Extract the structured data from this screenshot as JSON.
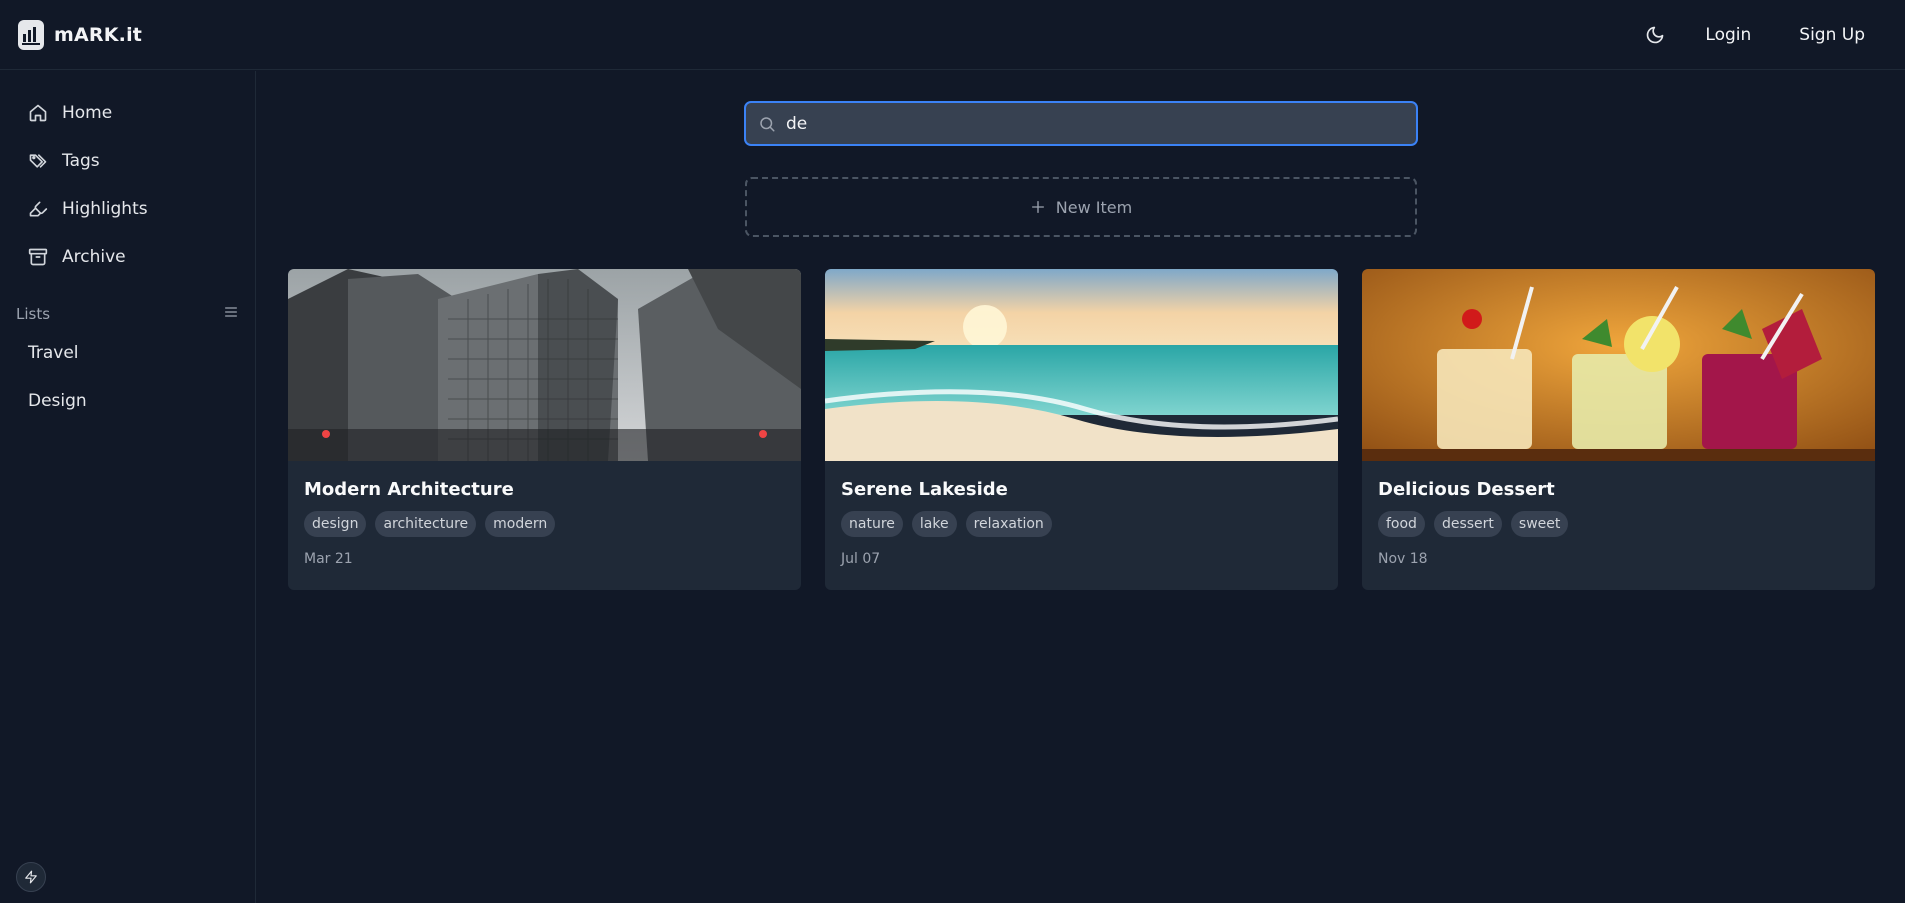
{
  "app": {
    "name": "mARK.it"
  },
  "header": {
    "theme_icon": "moon-icon",
    "login_label": "Login",
    "signup_label": "Sign Up"
  },
  "sidebar": {
    "items": [
      {
        "label": "Home",
        "icon": "home-icon"
      },
      {
        "label": "Tags",
        "icon": "tags-icon"
      },
      {
        "label": "Highlights",
        "icon": "highlighter-icon"
      },
      {
        "label": "Archive",
        "icon": "archive-icon"
      }
    ],
    "lists_title": "Lists",
    "lists": [
      {
        "label": "Travel"
      },
      {
        "label": "Design"
      }
    ]
  },
  "search": {
    "value": "de",
    "placeholder": ""
  },
  "new_item_label": "New Item",
  "cards": [
    {
      "title": "Modern Architecture",
      "tags": [
        "design",
        "architecture",
        "modern"
      ],
      "date": "Mar 21"
    },
    {
      "title": "Serene Lakeside",
      "tags": [
        "nature",
        "lake",
        "relaxation"
      ],
      "date": "Jul 07"
    },
    {
      "title": "Delicious Dessert",
      "tags": [
        "food",
        "dessert",
        "sweet"
      ],
      "date": "Nov 18"
    }
  ],
  "colors": {
    "background": "#111827",
    "card": "#1f2937",
    "accent": "#3b82f6"
  }
}
